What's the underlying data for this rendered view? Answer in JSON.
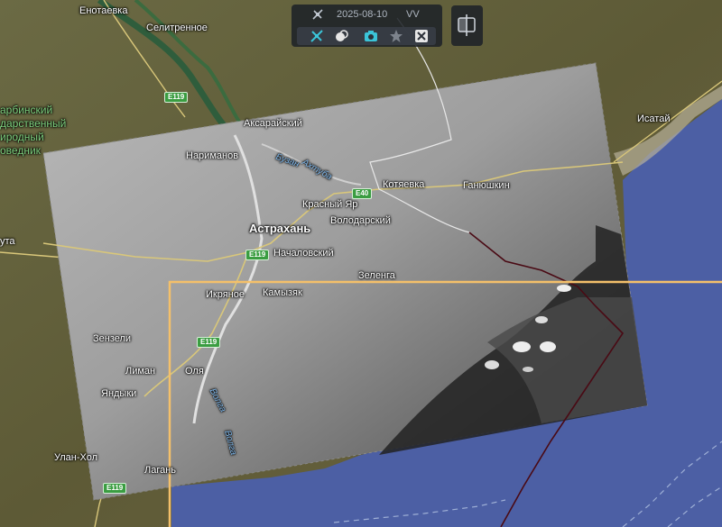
{
  "toolbar": {
    "date": "2025-08-10",
    "polarization": "VV",
    "icons": [
      "satellite-icon",
      "layers-icon",
      "camera-icon",
      "star-icon",
      "compare-icon",
      "split-view-icon"
    ],
    "accent_color": "#3bc4d8"
  },
  "map": {
    "places": {
      "enotaevka": "Енотаевка",
      "selitrennoe": "Селитренное",
      "reserve1": "арбинский",
      "reserve2": "дарственный",
      "reserve3": "иродный",
      "reserve4": "оведник",
      "aksaraisky": "Аксарайский",
      "narimanov": "Нариманов",
      "astrakhan": "Астрахань",
      "krasny_yar": "Красный Яр",
      "volodarsky": "Володарский",
      "kotyaevka": "Котяевка",
      "ganyushkin": "Ганюшкин",
      "isatay": "Исатай",
      "nachalovsky": "Началовский",
      "zelenga": "Зеленга",
      "ikryanoe": "Икряное",
      "kamyzyak": "Камызяк",
      "utta": "ута",
      "zenzeli": "Зензели",
      "liman": "Лиман",
      "olya": "Оля",
      "yandyki": "Яндыки",
      "ulan_khol": "Улан-Хол",
      "lagan": "Лагань"
    },
    "rivers": {
      "buzan": "Бузан",
      "akhtuba": "Ахтуба",
      "volga": "Волга",
      "volga_low": "Волга"
    },
    "roads": {
      "e119_a": "E119",
      "e119_b": "E119",
      "e119_c": "E119",
      "e119_d": "E119",
      "e40": "E40"
    },
    "colors": {
      "land": "#5b5b34",
      "sea": "#4c5fa4",
      "selection": "#f4c06a",
      "track": "#4a0a14",
      "boundary": "#e8e8e8"
    }
  }
}
